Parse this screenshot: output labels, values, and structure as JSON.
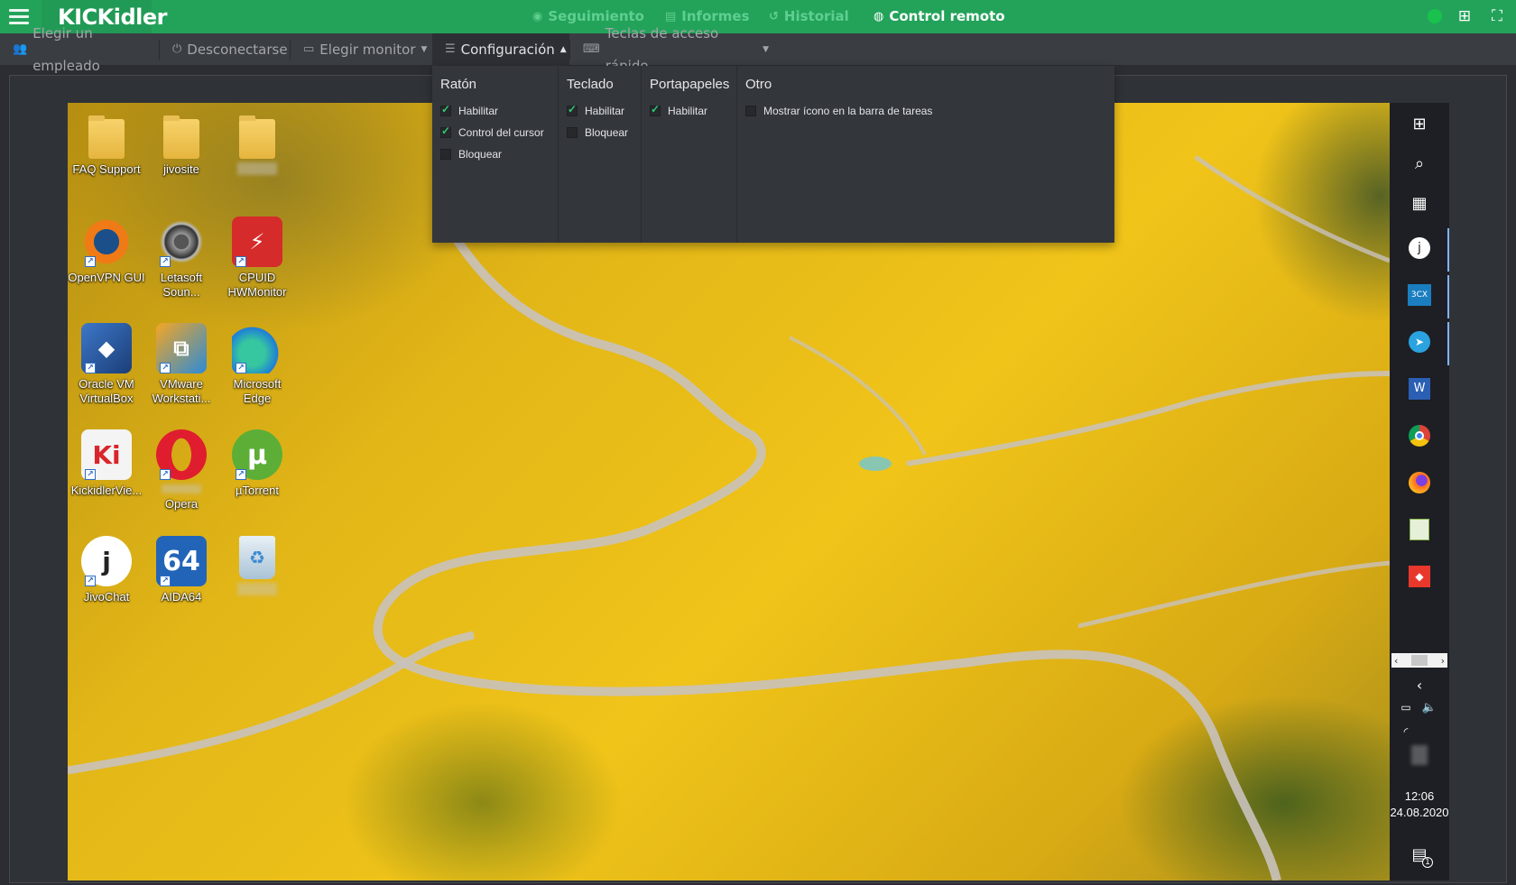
{
  "app": {
    "logo": "KICKidler",
    "nav": [
      {
        "label": "Seguimiento",
        "icon": "eye-icon"
      },
      {
        "label": "Informes",
        "icon": "document-icon"
      },
      {
        "label": "Historial",
        "icon": "history-icon"
      },
      {
        "label": "Control remoto",
        "icon": "remote-icon",
        "active": true
      }
    ],
    "colors": {
      "accent": "#23a35a",
      "status": "#19c24d"
    }
  },
  "toolbar": {
    "choose_employee": "Elegir un empleado",
    "disconnect": "Desconectarse",
    "choose_monitor": "Elegir monitor",
    "configuration": "Configuración",
    "hotkeys": "Teclas de acceso rápido"
  },
  "config": {
    "mouse": {
      "title": "Ratón",
      "options": [
        {
          "label": "Habilitar",
          "checked": true
        },
        {
          "label": "Control del cursor",
          "checked": true
        },
        {
          "label": "Bloquear",
          "checked": false
        }
      ]
    },
    "keyboard": {
      "title": "Teclado",
      "options": [
        {
          "label": "Habilitar",
          "checked": true
        },
        {
          "label": "Bloquear",
          "checked": false
        }
      ]
    },
    "clipboard": {
      "title": "Portapapeles",
      "options": [
        {
          "label": "Habilitar",
          "checked": true
        }
      ]
    },
    "other": {
      "title": "Otro",
      "options": [
        {
          "label": "Mostrar ícono en la barra de tareas",
          "checked": false
        }
      ]
    }
  },
  "desktop": {
    "icons": [
      {
        "label": "FAQ Support"
      },
      {
        "label": "jivosite"
      },
      {
        "label": "OpenVPN GUI"
      },
      {
        "label": "Letasoft Soun..."
      },
      {
        "label": "CPUID HWMonitor"
      },
      {
        "label": "Oracle VM VirtualBox"
      },
      {
        "label": "VMware Workstati..."
      },
      {
        "label": "Microsoft Edge"
      },
      {
        "label": "KickidlerVie..."
      },
      {
        "label": "Opera"
      },
      {
        "label": "µTorrent"
      },
      {
        "label": "JivoChat"
      },
      {
        "label": "AIDA64"
      }
    ]
  },
  "taskbar": {
    "time": "12:06",
    "date": "24.08.2020",
    "notifications": "1"
  }
}
